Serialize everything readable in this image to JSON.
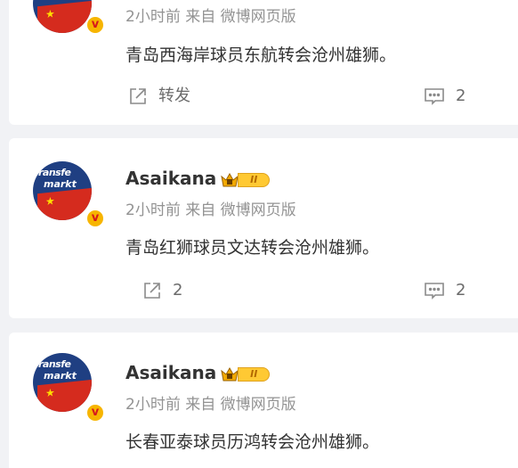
{
  "posts": [
    {
      "time": "2小时前",
      "source": "来自 微博网页版",
      "text": "青岛西海岸球员东航转会沧州雄狮。",
      "repost_label": "转发",
      "comment_count": "2"
    },
    {
      "author": "Asaikana",
      "level": "II",
      "time": "2小时前",
      "source": "来自 微博网页版",
      "text": "青岛红狮球员文达转会沧州雄狮。",
      "repost_count": "2",
      "comment_count": "2"
    },
    {
      "author": "Asaikana",
      "level": "II",
      "time": "2小时前",
      "source": "来自 微博网页版",
      "text": "长春亚泰球员历鸿转会沧州雄狮。"
    }
  ],
  "avatar": {
    "logo_line1": "ransfe",
    "logo_line2": "markt",
    "verified_mark": "v"
  },
  "colors": {
    "page_bg": "#f1f2f5",
    "card_bg": "#ffffff",
    "meta_text": "#939393",
    "crown_gold": "#ffc933",
    "verified_badge": "#f7b500"
  },
  "icons": [
    "repost-icon",
    "comment-icon",
    "crown-icon",
    "verified-icon",
    "star-icon"
  ]
}
